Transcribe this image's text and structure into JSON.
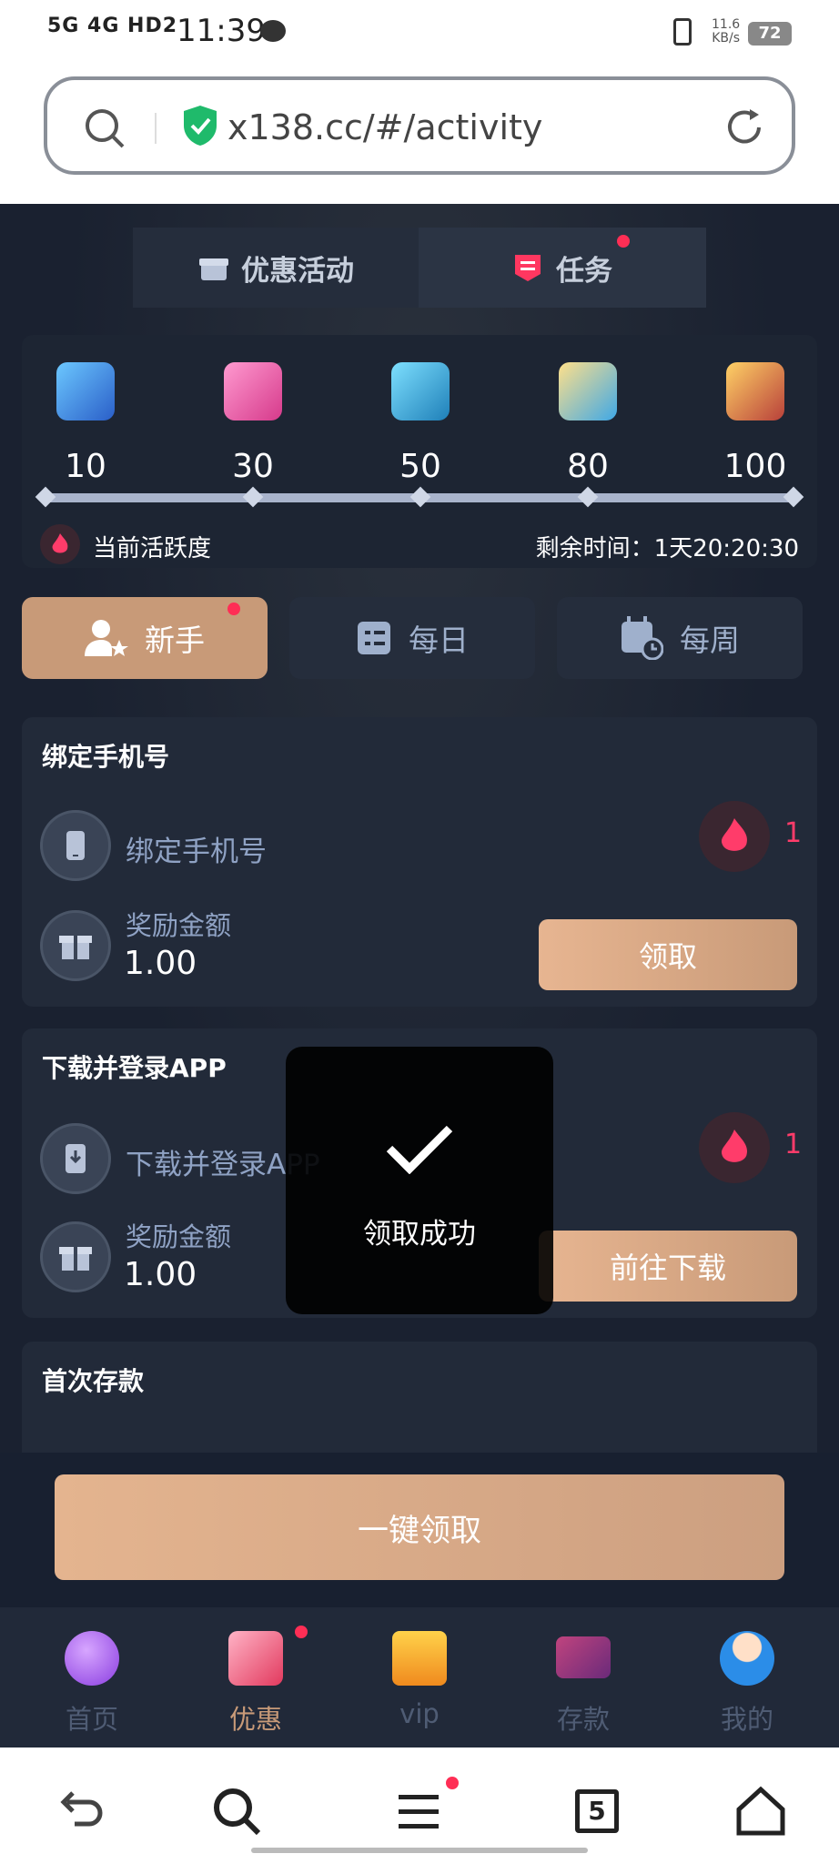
{
  "status": {
    "signal": "5G 4G HD2",
    "time": "11:39",
    "speed_value": "11.6",
    "speed_unit": "KB/s",
    "battery": "72"
  },
  "browser": {
    "url": "x138.cc/#/activity"
  },
  "top_tabs": [
    {
      "label": "优惠活动"
    },
    {
      "label": "任务"
    }
  ],
  "activity": {
    "levels": [
      "10",
      "30",
      "50",
      "80",
      "100"
    ],
    "current_label": "当前活跃度",
    "remaining_label": "剩余时间：",
    "remaining_value": "1天20:20:30"
  },
  "categories": [
    {
      "label": "新手"
    },
    {
      "label": "每日"
    },
    {
      "label": "每周"
    }
  ],
  "tasks": [
    {
      "title": "绑定手机号",
      "name": "绑定手机号",
      "reward_label": "奖励金额",
      "reward": "1.00",
      "count": "1",
      "button": "领取"
    },
    {
      "title": "下载并登录APP",
      "name": "下载并登录APP",
      "reward_label": "奖励金额",
      "reward": "1.00",
      "count": "1",
      "button": "前往下载"
    },
    {
      "title": "首次存款"
    }
  ],
  "toast": {
    "message": "领取成功"
  },
  "claim_all": "一键领取",
  "tabbar": [
    {
      "label": "首页"
    },
    {
      "label": "优惠"
    },
    {
      "label": "vip"
    },
    {
      "label": "存款"
    },
    {
      "label": "我的"
    }
  ],
  "nav": {
    "tabs_count": "5"
  },
  "colors": {
    "accent": "#c89a78",
    "bg": "#1a2130",
    "badge": "#ff2e55",
    "fire": "#ff3c6a"
  }
}
